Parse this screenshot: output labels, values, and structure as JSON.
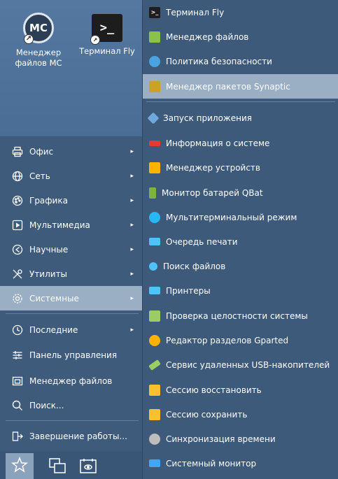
{
  "desktop": {
    "icons": [
      {
        "label_line1": "Менеджер",
        "label_line2": "файлов MC",
        "glyph": "MC"
      },
      {
        "label_line1": "Терминал Fly",
        "label_line2": "",
        "glyph": ">_"
      }
    ]
  },
  "categories": [
    {
      "label": "Офис",
      "icon": "printer-icon",
      "has_submenu": true
    },
    {
      "label": "Сеть",
      "icon": "globe-icon",
      "has_submenu": true
    },
    {
      "label": "Графика",
      "icon": "palette-icon",
      "has_submenu": true
    },
    {
      "label": "Мультимедиа",
      "icon": "play-icon",
      "has_submenu": true
    },
    {
      "label": "Научные",
      "icon": "science-icon",
      "has_submenu": true
    },
    {
      "label": "Утилиты",
      "icon": "tools-icon",
      "has_submenu": true
    },
    {
      "label": "Системные",
      "icon": "gear-icon",
      "has_submenu": true,
      "selected": true
    }
  ],
  "actions": [
    {
      "label": "Последние",
      "icon": "clock-icon",
      "has_submenu": true
    },
    {
      "label": "Панель управления",
      "icon": "sliders-icon",
      "has_submenu": false
    },
    {
      "label": "Менеджер файлов",
      "icon": "file-manager-icon",
      "has_submenu": false
    },
    {
      "label": "Поиск...",
      "icon": "search-icon",
      "has_submenu": false
    }
  ],
  "shutdown": {
    "label": "Завершение работы...",
    "icon": "logout-icon"
  },
  "arrow": "▸",
  "submenu": [
    {
      "label": "Терминал Fly",
      "icon": "terminal-icon",
      "color": "#1e1e1e"
    },
    {
      "label": "Менеджер файлов",
      "icon": "file-manager-icon",
      "color": "#8bc34a"
    },
    {
      "label": "Политика безопасности",
      "icon": "shield-icon",
      "color": "#4aa3df"
    },
    {
      "label": "Менеджер пакетов Synaptic",
      "icon": "package-icon",
      "color": "#c9a227",
      "selected": true
    },
    {
      "label": "Запуск приложения",
      "icon": "rocket-icon",
      "color": "#6fa8dc"
    },
    {
      "label": "Информация о системе",
      "icon": "info-icon",
      "color": "#e53935"
    },
    {
      "label": "Менеджер устройств",
      "icon": "device-icon",
      "color": "#ffb300"
    },
    {
      "label": "Монитор батарей QBat",
      "icon": "battery-icon",
      "color": "#7cb342"
    },
    {
      "label": "Мультитерминальный режим",
      "icon": "multiterminal-icon",
      "color": "#29b6f6"
    },
    {
      "label": "Очередь печати",
      "icon": "print-queue-icon",
      "color": "#4fc3f7"
    },
    {
      "label": "Поиск файлов",
      "icon": "file-search-icon",
      "color": "#4fc3f7"
    },
    {
      "label": "Принтеры",
      "icon": "printer-icon",
      "color": "#4fc3f7"
    },
    {
      "label": "Проверка целостности системы",
      "icon": "integrity-icon",
      "color": "#9ccc65"
    },
    {
      "label": "Редактор разделов Gparted",
      "icon": "gparted-icon",
      "color": "#ffb300"
    },
    {
      "label": "Сервис удаленных USB-накопителей",
      "icon": "usb-icon",
      "color": "#9ccc65"
    },
    {
      "label": "Сессию восстановить",
      "icon": "session-restore-icon",
      "color": "#fbc02d"
    },
    {
      "label": "Сессию сохранить",
      "icon": "session-save-icon",
      "color": "#fbc02d"
    },
    {
      "label": "Синхронизация времени",
      "icon": "time-sync-icon",
      "color": "#bdbdbd"
    },
    {
      "label": "Системный монитор",
      "icon": "system-monitor-icon",
      "color": "#42a5f5"
    }
  ],
  "taskbar": [
    {
      "icon": "star-icon"
    },
    {
      "icon": "windows-icon"
    },
    {
      "icon": "desktop-eye-icon"
    }
  ]
}
